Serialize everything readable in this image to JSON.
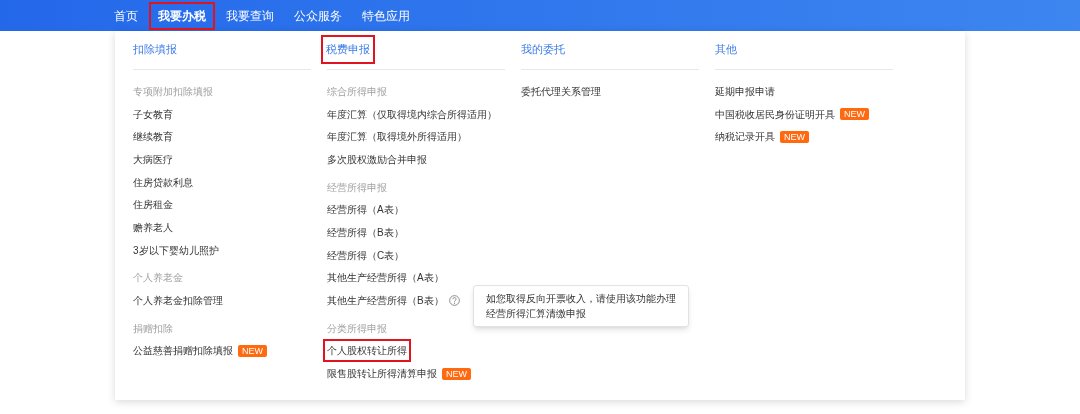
{
  "nav": [
    {
      "label": "首页",
      "selected": false,
      "highlighted": false
    },
    {
      "label": "我要办税",
      "selected": true,
      "highlighted": true
    },
    {
      "label": "我要查询",
      "selected": false,
      "highlighted": false
    },
    {
      "label": "公众服务",
      "selected": false,
      "highlighted": false
    },
    {
      "label": "特色应用",
      "selected": false,
      "highlighted": false
    }
  ],
  "columns": [
    {
      "heading": "扣除填报",
      "highlighted": false,
      "items": [
        {
          "kind": "group",
          "label": "专项附加扣除填报"
        },
        {
          "kind": "link",
          "label": "子女教育"
        },
        {
          "kind": "link",
          "label": "继续教育"
        },
        {
          "kind": "link",
          "label": "大病医疗"
        },
        {
          "kind": "link",
          "label": "住房贷款利息"
        },
        {
          "kind": "link",
          "label": "住房租金"
        },
        {
          "kind": "link",
          "label": "赡养老人"
        },
        {
          "kind": "link",
          "label": "3岁以下婴幼儿照护"
        },
        {
          "kind": "group",
          "label": "个人养老金"
        },
        {
          "kind": "link",
          "label": "个人养老金扣除管理"
        },
        {
          "kind": "group",
          "label": "捐赠扣除"
        },
        {
          "kind": "link",
          "label": "公益慈善捐赠扣除填报",
          "badge": "NEW"
        }
      ]
    },
    {
      "heading": "税费申报",
      "highlighted": true,
      "items": [
        {
          "kind": "group",
          "label": "综合所得申报"
        },
        {
          "kind": "link",
          "label": "年度汇算（仅取得境内综合所得适用）"
        },
        {
          "kind": "link",
          "label": "年度汇算（取得境外所得适用）"
        },
        {
          "kind": "link",
          "label": "多次股权激励合并申报"
        },
        {
          "kind": "group",
          "label": "经营所得申报"
        },
        {
          "kind": "link",
          "label": "经营所得（A表）"
        },
        {
          "kind": "link",
          "label": "经营所得（B表）"
        },
        {
          "kind": "link",
          "label": "经营所得（C表）"
        },
        {
          "kind": "link",
          "label": "其他生产经营所得（A表）"
        },
        {
          "kind": "link",
          "label": "其他生产经营所得（B表）",
          "help": true,
          "tooltip": [
            "如您取得反向开票收入，请使用该功能办理",
            "经营所得汇算清缴申报"
          ]
        },
        {
          "kind": "group",
          "label": "分类所得申报"
        },
        {
          "kind": "link",
          "label": "个人股权转让所得",
          "highlighted": true
        },
        {
          "kind": "link",
          "label": "限售股转让所得清算申报",
          "badge": "NEW"
        }
      ]
    },
    {
      "heading": "我的委托",
      "highlighted": false,
      "items": [
        {
          "kind": "link",
          "label": "委托代理关系管理"
        }
      ]
    },
    {
      "heading": "其他",
      "highlighted": false,
      "items": [
        {
          "kind": "link",
          "label": "延期申报申请"
        },
        {
          "kind": "link",
          "label": "中国税收居民身份证明开具",
          "badge": "NEW"
        },
        {
          "kind": "link",
          "label": "纳税记录开具",
          "badge": "NEW"
        }
      ]
    }
  ]
}
